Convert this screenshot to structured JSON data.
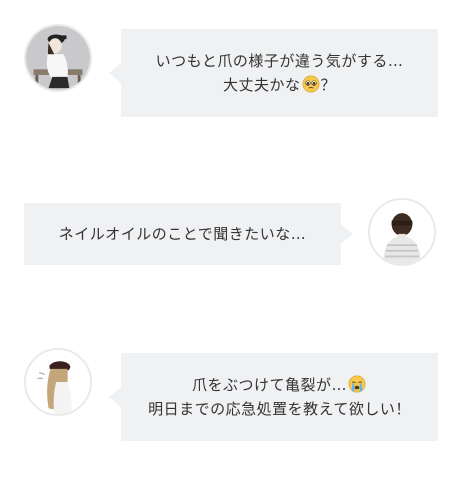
{
  "messages": [
    {
      "side": "left",
      "line1": "いつもと爪の様子が違う気がする…",
      "line2_before": "大丈夫かな",
      "line2_emoji": "pleading-face-emoji",
      "line2_after": "？"
    },
    {
      "side": "right",
      "line1": "ネイルオイルのことで聞きたいな…"
    },
    {
      "side": "left",
      "line1_before": "爪をぶつけて亀裂が…",
      "line1_emoji": "loudly-crying-face-emoji",
      "line2": "明日までの応急処置を教えて欲しい！"
    }
  ],
  "colors": {
    "bubble": "#f0f1f3",
    "text": "#333333",
    "avatar_border": "#e9e9e9"
  }
}
